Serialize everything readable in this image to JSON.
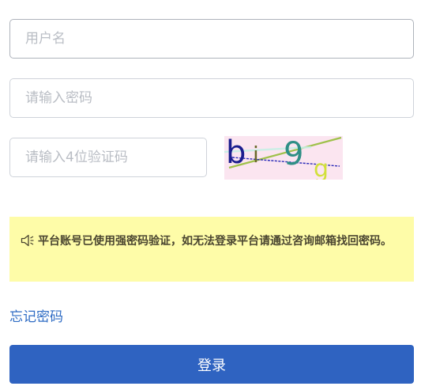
{
  "form": {
    "username_placeholder": "用户名",
    "password_placeholder": "请输入密码",
    "captcha_placeholder": "请输入4位验证码"
  },
  "captcha": {
    "chars": [
      "b",
      "i",
      "9",
      "g"
    ],
    "colors": [
      "#1b1d8e",
      "#6a6a2a",
      "#2f8f86",
      "#d2e03a"
    ]
  },
  "notice": {
    "icon": "speaker-icon",
    "text": "平台账号已使用强密码验证，如无法登录平台请通过咨询邮箱找回密码。"
  },
  "links": {
    "forgot_password": "忘记密码"
  },
  "buttons": {
    "login": "登录"
  },
  "colors": {
    "primary": "#2f63c1",
    "link": "#2f6cc4",
    "notice_bg": "#fefca8",
    "captcha_bg": "#fbe5f0"
  }
}
